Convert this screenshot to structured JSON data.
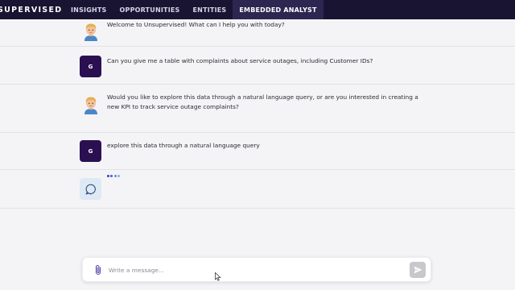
{
  "app": {
    "brand": "SUPERVISED",
    "nav_tabs": [
      {
        "label": "INSIGHTS"
      },
      {
        "label": "OPPORTUNITIES"
      },
      {
        "label": "ENTITIES"
      },
      {
        "label": "EMBEDDED ANALYST",
        "active": true
      }
    ]
  },
  "chat": {
    "messages": [
      {
        "sender": "assistant",
        "avatar_icon": "assistant-avatar-icon",
        "text": "Welcome to Unsupervised! What can I help you with today?"
      },
      {
        "sender": "user",
        "avatar_initial": "G",
        "text": "Can you give me a table with complaints about service outages, including Customer IDs?"
      },
      {
        "sender": "assistant",
        "avatar_icon": "assistant-avatar-icon",
        "text": "Would you like to explore this data through a natural language query, or are you interested in creating a new KPI to track service outage complaints?"
      },
      {
        "sender": "user",
        "avatar_initial": "G",
        "text": "explore this data through a natural language query"
      },
      {
        "sender": "assistant",
        "state": "thinking",
        "avatar_icon": "chat-bubble-icon"
      }
    ]
  },
  "composer": {
    "placeholder": "Write a message...",
    "value": ""
  },
  "icons": {
    "attach": "paperclip-icon",
    "send": "send-icon",
    "thinking": "chat-bubble-icon"
  },
  "colors": {
    "topbar": "#1a1433",
    "active_tab": "#2d2650",
    "user_avatar": "#2a1050",
    "typing_dots": [
      "#4b3fb0",
      "#5b5bd0",
      "#6f8ee0",
      "#86b6ee"
    ],
    "background": "#f4f4f6"
  }
}
